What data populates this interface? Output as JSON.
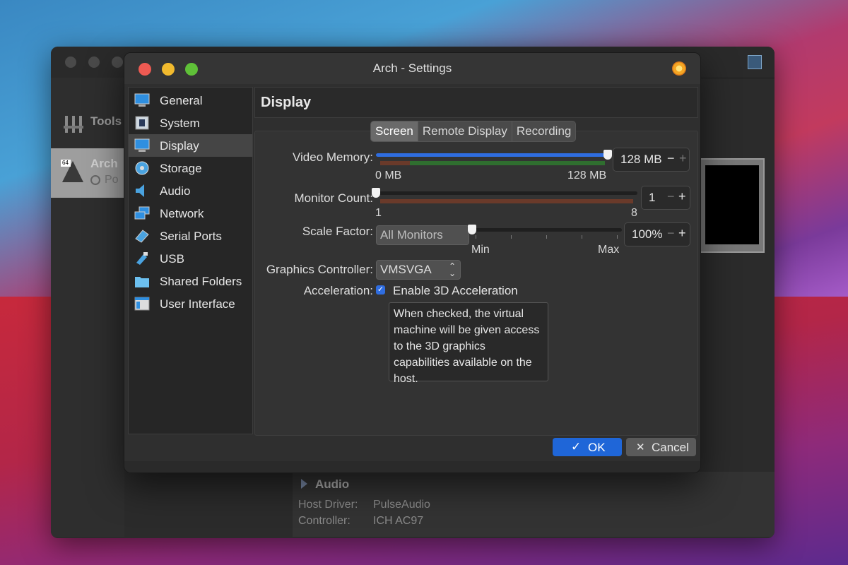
{
  "background_app": {
    "tools_label": "Tools",
    "vm": {
      "name": "Arch",
      "state": "Po",
      "badge": "64"
    },
    "audio": {
      "title": "Audio",
      "rows": [
        {
          "label": "Host Driver:",
          "value": "PulseAudio"
        },
        {
          "label": "Controller:",
          "value": "ICH AC97"
        }
      ]
    }
  },
  "dialog": {
    "title": "Arch - Settings",
    "sidebar": {
      "items": [
        {
          "label": "General",
          "icon": "monitor-icon"
        },
        {
          "label": "System",
          "icon": "chip-icon"
        },
        {
          "label": "Display",
          "icon": "display-icon",
          "selected": true
        },
        {
          "label": "Storage",
          "icon": "disk-icon"
        },
        {
          "label": "Audio",
          "icon": "speaker-icon"
        },
        {
          "label": "Network",
          "icon": "network-icon"
        },
        {
          "label": "Serial Ports",
          "icon": "serial-port-icon"
        },
        {
          "label": "USB",
          "icon": "usb-icon"
        },
        {
          "label": "Shared Folders",
          "icon": "folder-icon"
        },
        {
          "label": "User Interface",
          "icon": "window-icon"
        }
      ]
    },
    "panel_title": "Display",
    "tabs": [
      {
        "label": "Screen",
        "active": true
      },
      {
        "label": "Remote Display"
      },
      {
        "label": "Recording"
      }
    ],
    "video_memory": {
      "label": "Video Memory:",
      "value": "128 MB",
      "min_label": "0 MB",
      "max_label": "128 MB",
      "level": 1.0
    },
    "monitor_count": {
      "label": "Monitor Count:",
      "value": "1",
      "min_label": "1",
      "max_label": "8",
      "level": 0.0
    },
    "scale_factor": {
      "label": "Scale Factor:",
      "monitors_select": "All Monitors",
      "value": "100%",
      "min_label": "Min",
      "max_label": "Max",
      "level": 0.0
    },
    "graphics_controller": {
      "label": "Graphics Controller:",
      "value": "VMSVGA"
    },
    "acceleration": {
      "label": "Acceleration:",
      "checkbox_label": "Enable 3D Acceleration",
      "checked": true
    },
    "tooltip": "When checked, the virtual machine will be given access to the 3D graphics capabilities available on the host.",
    "buttons": {
      "ok": "OK",
      "cancel": "Cancel"
    }
  },
  "colors": {
    "accent": "#2f6de0",
    "ok_button": "#1f66d8",
    "close": "#ee5a52",
    "minimize": "#f1ba2e",
    "zoom": "#5fc038"
  }
}
